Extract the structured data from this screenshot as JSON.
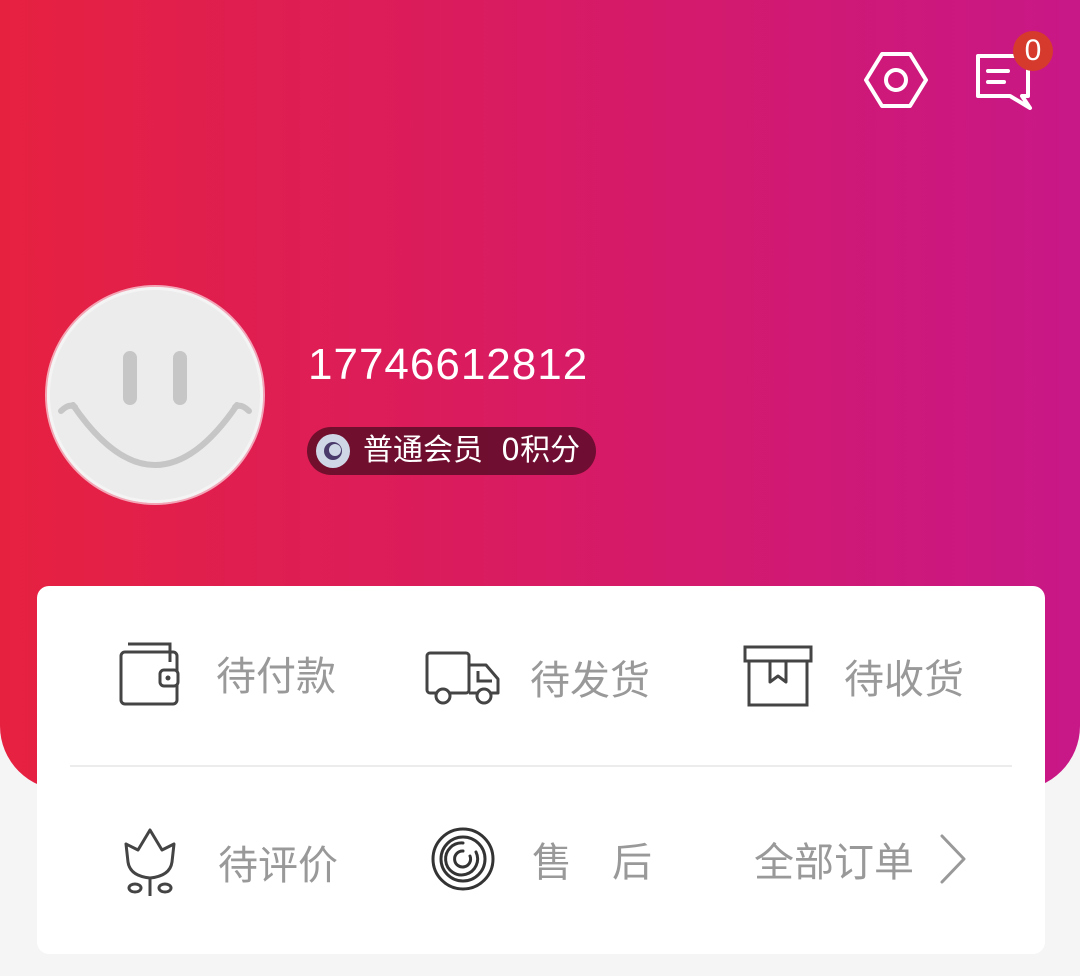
{
  "header": {
    "settings_icon": "gear-icon",
    "messages_icon": "chat-icon",
    "message_count": "0",
    "gradient_colors": [
      "#e62140",
      "#c81787"
    ]
  },
  "profile": {
    "phone": "17746612812",
    "member_level": "普通会员",
    "points": "0积分"
  },
  "orders": {
    "row1": [
      {
        "label": "待付款",
        "icon": "wallet-icon"
      },
      {
        "label": "待发货",
        "icon": "truck-icon"
      },
      {
        "label": "待收货",
        "icon": "box-icon"
      }
    ],
    "row2": [
      {
        "label": "待评价",
        "icon": "tulip-icon"
      },
      {
        "label": "售　后",
        "icon": "spiral-icon"
      }
    ],
    "all_orders_label": "全部订单"
  }
}
